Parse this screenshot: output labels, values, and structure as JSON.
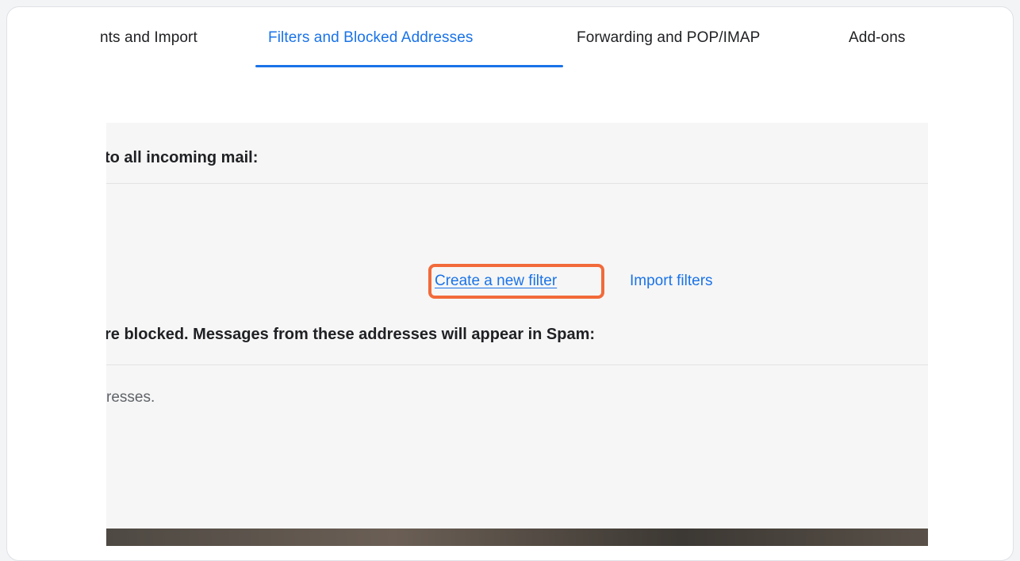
{
  "tabs": [
    {
      "label": "nts and Import",
      "active": false
    },
    {
      "label": "Filters and Blocked Addresses",
      "active": true
    },
    {
      "label": "Forwarding and POP/IMAP",
      "active": false
    },
    {
      "label": "Add-ons",
      "active": false
    }
  ],
  "filters": {
    "heading": "to all incoming mail:",
    "create_link": "Create a new filter",
    "import_link": "Import filters"
  },
  "blocked": {
    "heading": "re blocked. Messages from these addresses will appear in Spam:",
    "empty_text": "resses."
  },
  "colors": {
    "accent": "#1a73e8",
    "highlight": "#f26a3a"
  }
}
